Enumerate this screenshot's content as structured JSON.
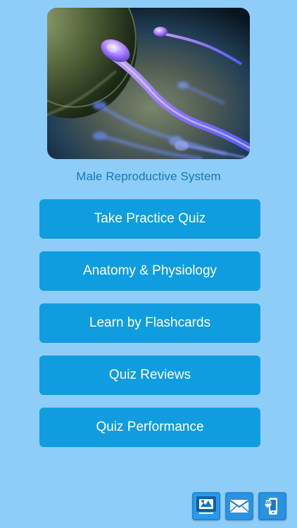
{
  "app": {
    "title": "Male Reproductive System"
  },
  "menu": {
    "items": [
      {
        "label": "Take Practice Quiz"
      },
      {
        "label": "Anatomy & Physiology"
      },
      {
        "label": "Learn by Flashcards"
      },
      {
        "label": "Quiz Reviews"
      },
      {
        "label": "Quiz Performance"
      }
    ]
  },
  "toolbar": {
    "sms_label": "SMS"
  },
  "icons": {
    "share": "share-icon",
    "mail": "mail-icon",
    "sms": "sms-phone-icon"
  },
  "colors": {
    "background": "#8ecdf8",
    "title": "#1677b8",
    "button": "#0f9de0",
    "button_text": "#ffffff",
    "toolbar_icon": "#1e84d5"
  }
}
